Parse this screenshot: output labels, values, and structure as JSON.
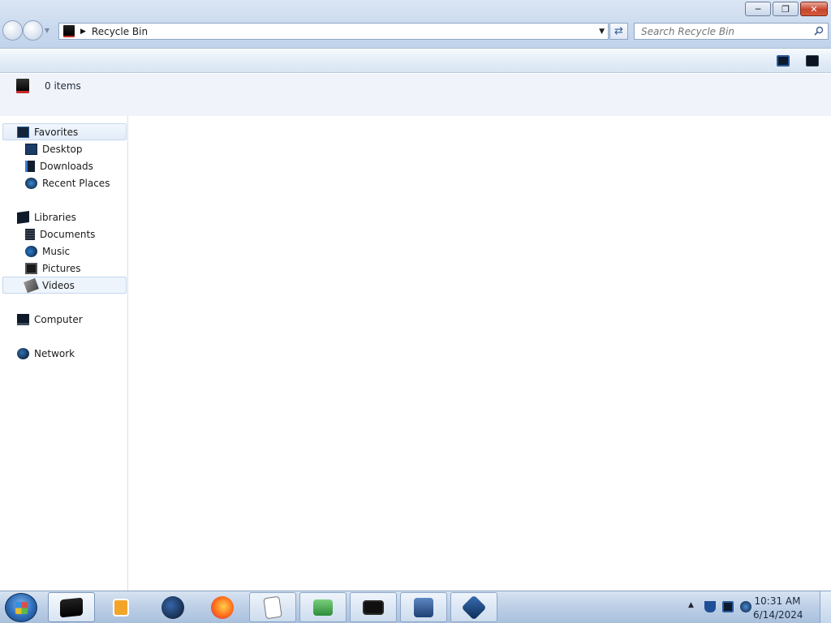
{
  "window": {
    "address": {
      "location": "Recycle Bin"
    },
    "search": {
      "placeholder": "Search Recycle Bin"
    },
    "details": {
      "item_count": "0 items"
    }
  },
  "nav": {
    "favorites": {
      "label": "Favorites",
      "items": [
        {
          "label": "Desktop"
        },
        {
          "label": "Downloads"
        },
        {
          "label": "Recent Places"
        }
      ]
    },
    "libraries": {
      "label": "Libraries",
      "items": [
        {
          "label": "Documents"
        },
        {
          "label": "Music"
        },
        {
          "label": "Pictures"
        },
        {
          "label": "Videos"
        }
      ]
    },
    "computer": {
      "label": "Computer"
    },
    "network": {
      "label": "Network"
    }
  },
  "taskbar": {
    "items": [
      "explorer-icon",
      "media-player-icon",
      "globe-icon",
      "firefox-icon",
      "solitaire-icon",
      "screen-capture-icon",
      "drive-icon",
      "network-computer-icon",
      "virtualbox-icon"
    ],
    "clock": {
      "time": "10:31 AM",
      "date": "6/14/2024"
    }
  },
  "colors": {
    "accent": "#c0d2ea",
    "close_button": "#c8452c",
    "selection": "#eef4fc"
  }
}
